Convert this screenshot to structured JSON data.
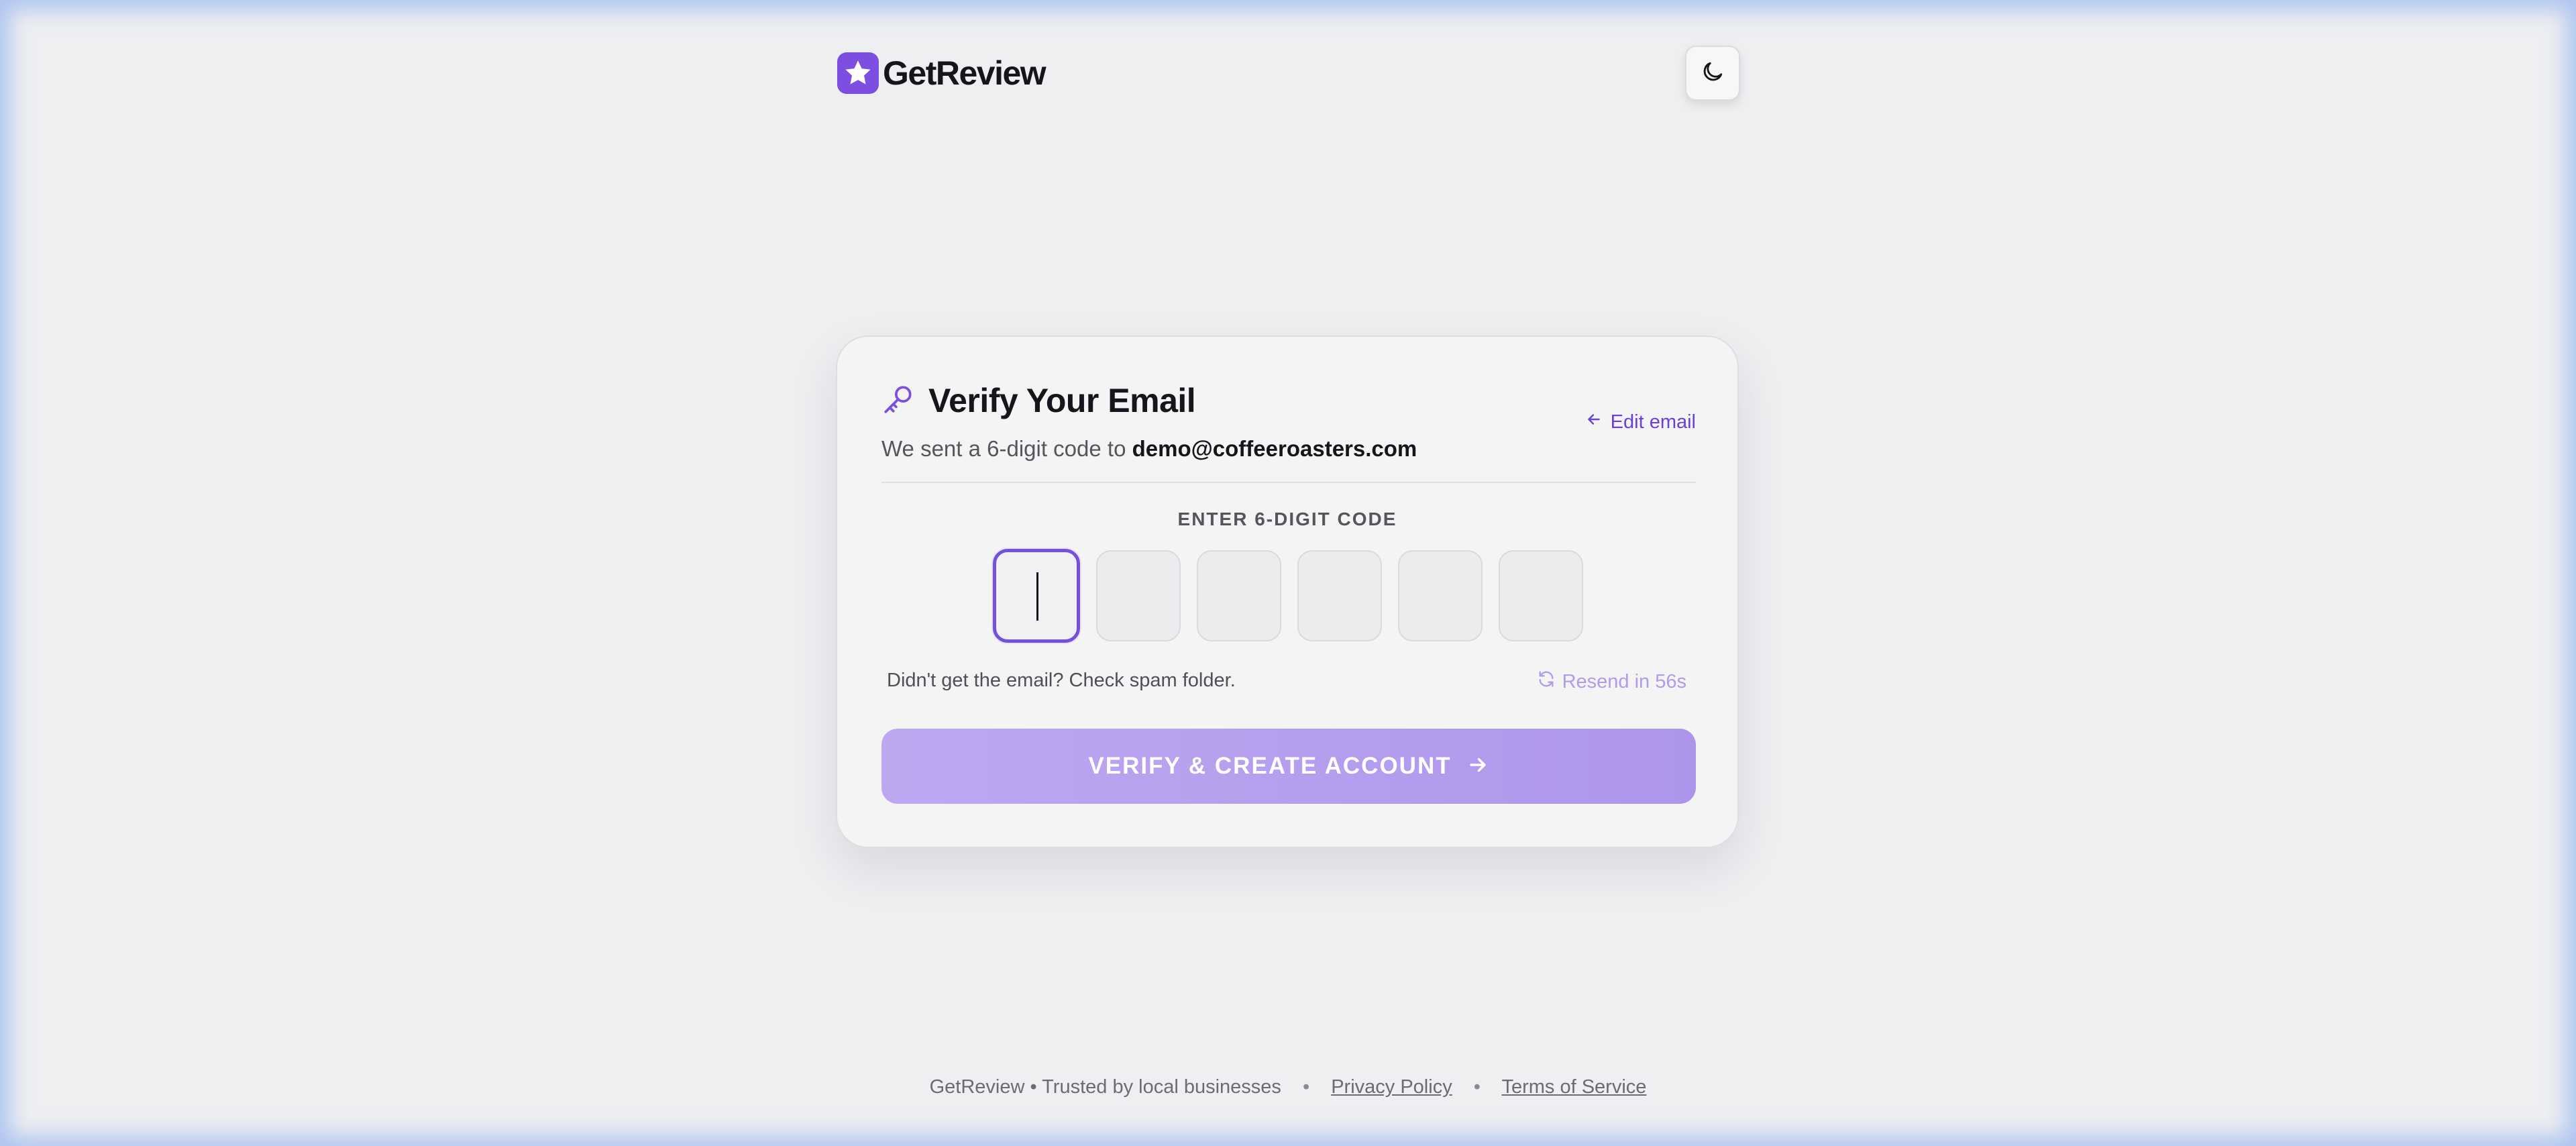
{
  "brand": {
    "name": "GetReview",
    "accent_color": "#7c4fe0",
    "icon": "star-icon"
  },
  "header": {
    "theme_toggle_icon": "moon-icon"
  },
  "card": {
    "title_icon": "key-icon",
    "title": "Verify Your Email",
    "subtitle_prefix": "We sent a 6-digit code to",
    "email": "demo@coffeeroasters.com",
    "edit_email_label": "Edit email",
    "edit_email_icon": "arrow-left-icon",
    "code_label": "ENTER 6-DIGIT CODE",
    "code_digits": [
      "",
      "",
      "",
      "",
      "",
      ""
    ],
    "active_digit_index": 0,
    "hint_text": "Didn't get the email? Check spam folder.",
    "resend_label": "Resend in 56s",
    "resend_icon": "refresh-icon",
    "submit_label": "VERIFY & CREATE ACCOUNT",
    "submit_icon": "arrow-right-icon"
  },
  "footer": {
    "tagline": "GetReview • Trusted by local businesses",
    "separator": "•",
    "privacy_label": "Privacy Policy",
    "terms_label": "Terms of Service"
  }
}
